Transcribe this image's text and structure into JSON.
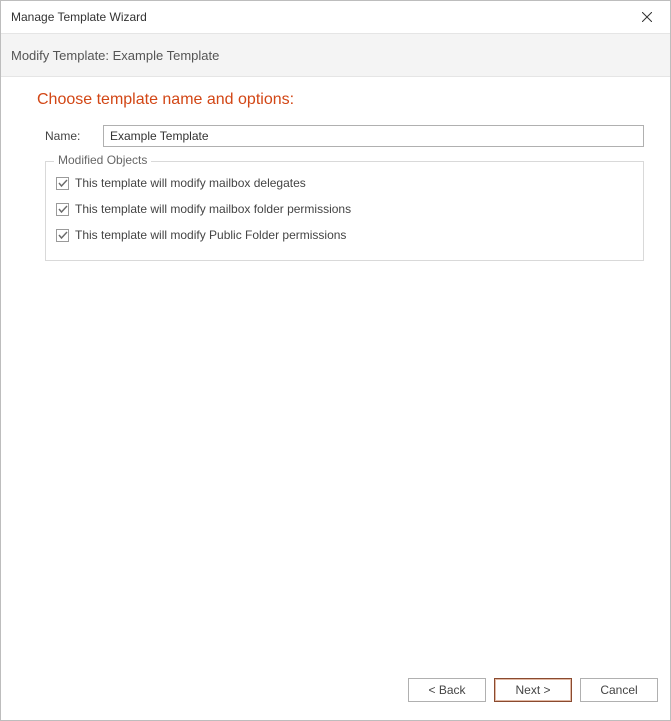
{
  "titlebar": {
    "title": "Manage Template Wizard"
  },
  "subheader": {
    "text": "Modify Template: Example Template"
  },
  "page": {
    "heading": "Choose template name and options:",
    "name_label": "Name:",
    "name_value": "Example Template"
  },
  "fieldset": {
    "legend": "Modified Objects",
    "items": [
      {
        "checked": true,
        "label": "This template will modify mailbox delegates"
      },
      {
        "checked": true,
        "label": "This template will modify mailbox folder permissions"
      },
      {
        "checked": true,
        "label": "This template will modify Public Folder permissions"
      }
    ]
  },
  "footer": {
    "back": "< Back",
    "next": "Next >",
    "cancel": "Cancel"
  }
}
